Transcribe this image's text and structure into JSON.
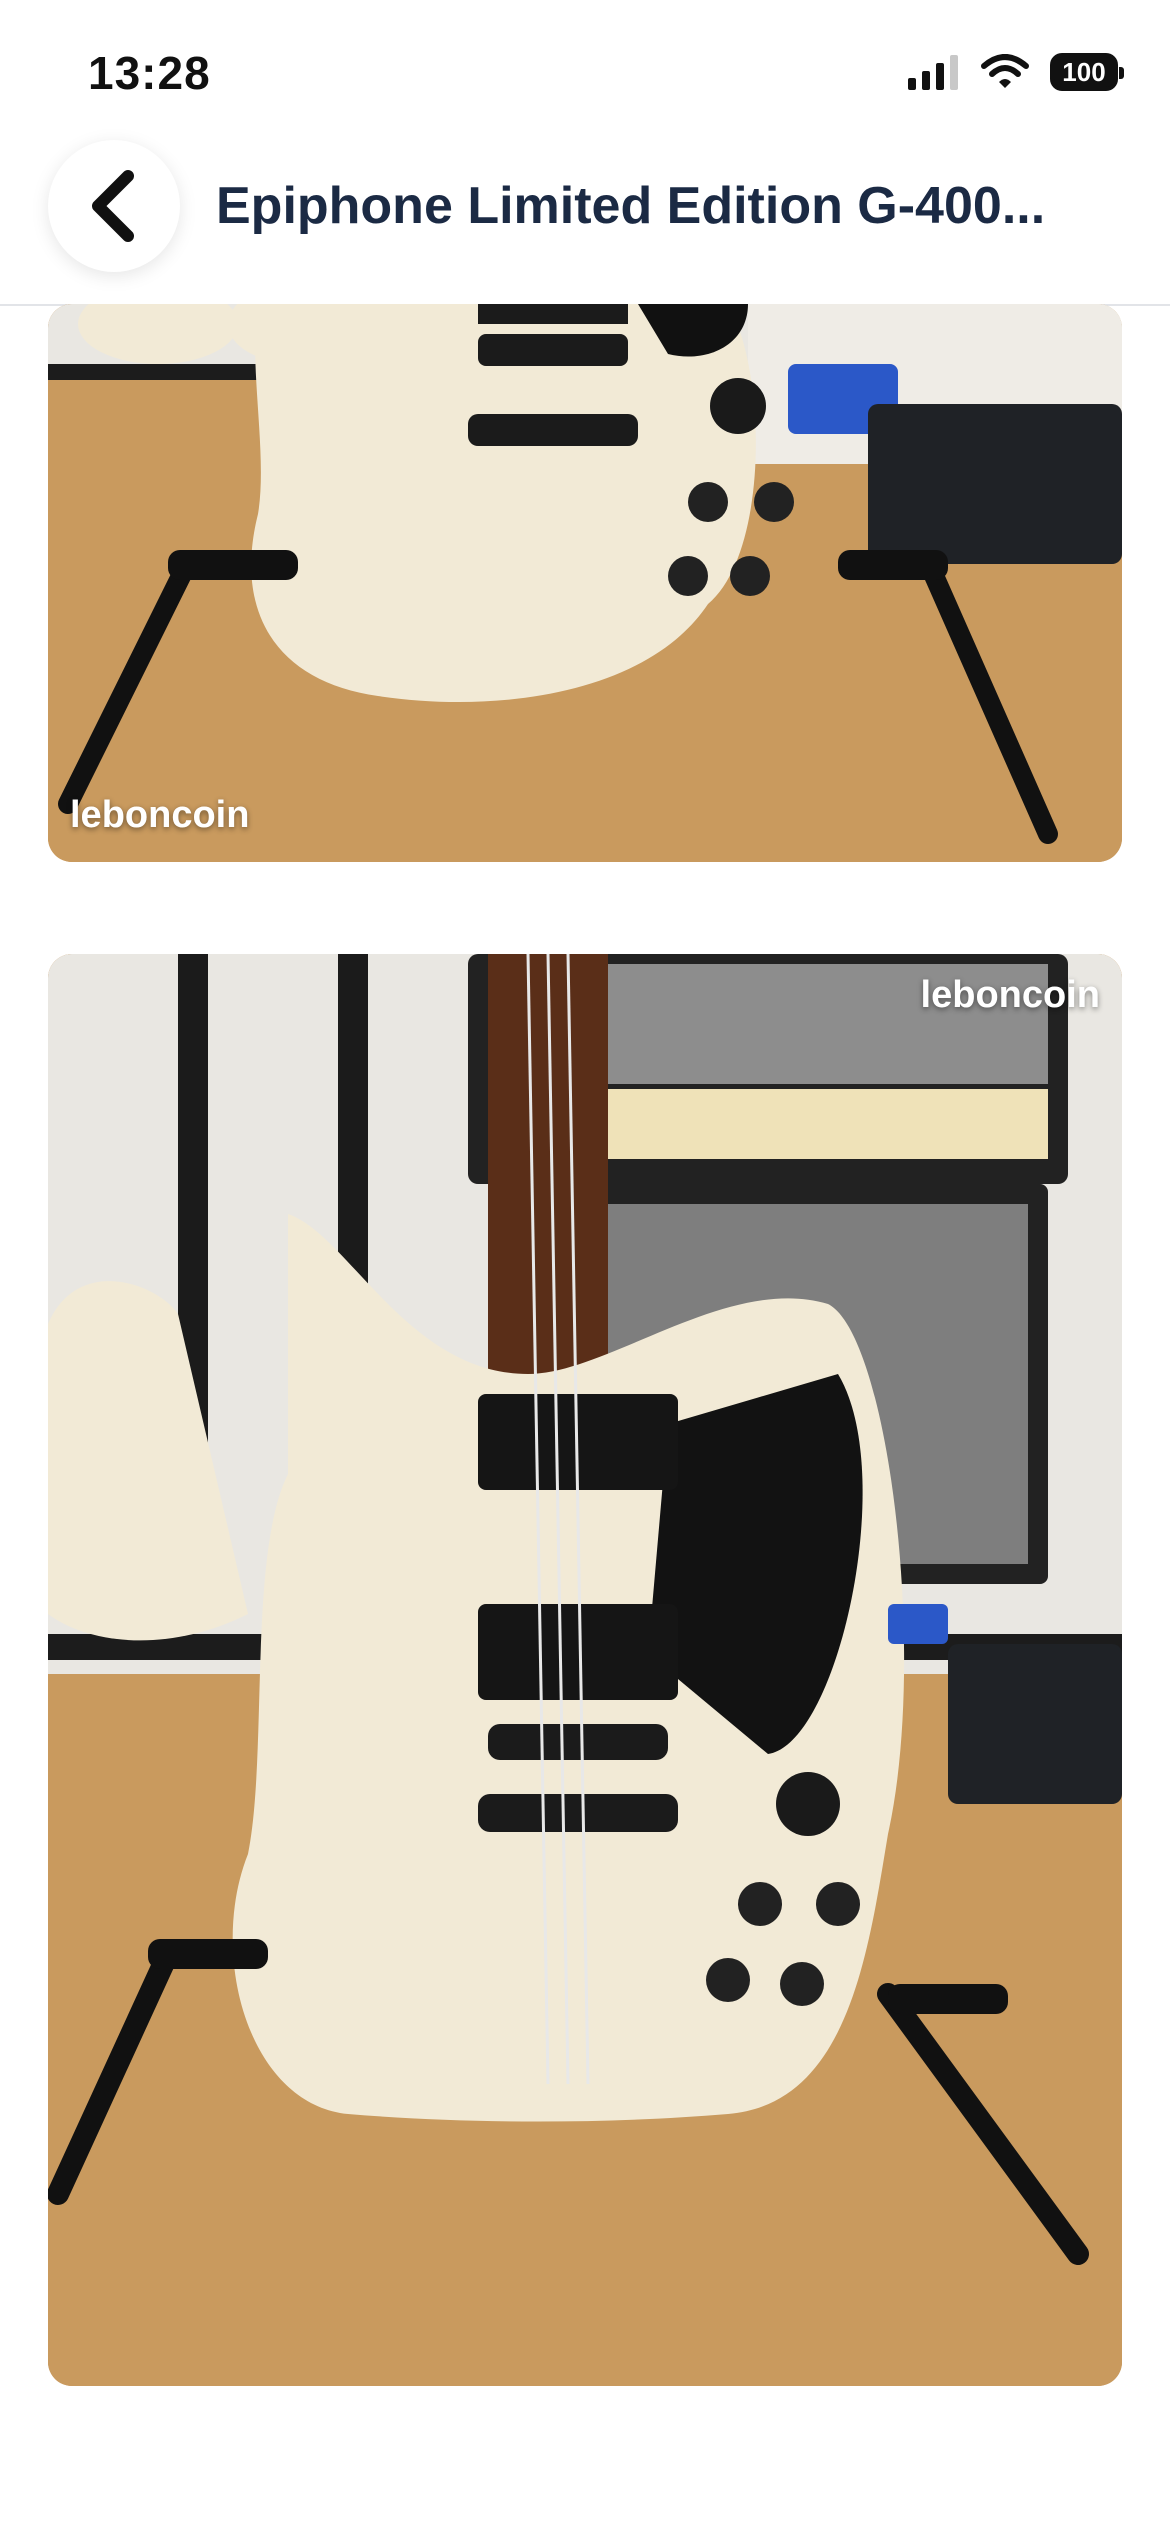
{
  "status_bar": {
    "time": "13:28",
    "battery": "100",
    "icons": [
      "signal-icon",
      "wifi-icon",
      "battery-icon"
    ]
  },
  "header": {
    "title": "Epiphone Limited Edition G-400...",
    "back_icon": "chevron-left-icon"
  },
  "gallery": {
    "photos": [
      {
        "watermark": "leboncoin",
        "subject": "white SG guitar body on stand, cropped top"
      },
      {
        "watermark": "leboncoin",
        "subject": "white SG guitar on stand in front of amplifier"
      }
    ]
  },
  "colors": {
    "title": "#1b2a44",
    "divider": "#e2e4e8",
    "guitar": "#f2ead6",
    "wood": "#c99a5e"
  }
}
